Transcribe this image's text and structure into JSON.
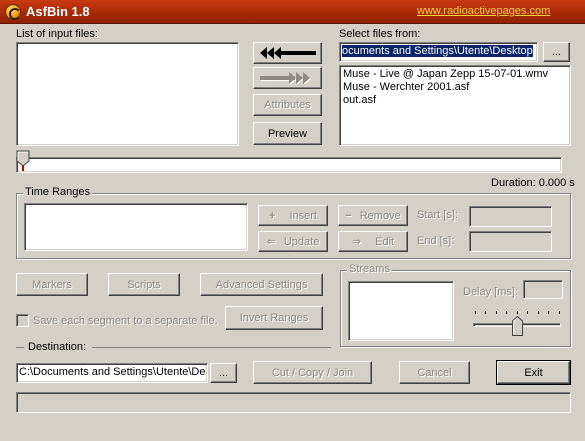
{
  "window": {
    "title": "AsfBin 1.8",
    "link": "www.radioactivepages.com"
  },
  "input_files": {
    "label": "List of input files:",
    "items": []
  },
  "select_files": {
    "label": "Select files from:",
    "path": "ocuments and Settings\\Utente\\Desktop",
    "browse_label": "...",
    "files": [
      "Muse - Live @ Japan Zepp 15-07-01.wmv",
      "Muse - Werchter 2001.asf",
      "out.asf"
    ]
  },
  "buttons": {
    "attributes": "Attributes",
    "preview": "Preview",
    "markers": "Markers",
    "scripts": "Scripts",
    "advanced_settings": "Advanced Settings",
    "invert_ranges": "Invert Ranges",
    "cut_copy_join": "Cut / Copy / Join",
    "cancel": "Cancel",
    "exit": "Exit",
    "destination_browse": "..."
  },
  "timeline": {
    "duration_label": "Duration: 0.000 s",
    "position": 0
  },
  "time_ranges": {
    "label": "Time Ranges",
    "insert": "Insert",
    "remove": "Remove",
    "update": "Update",
    "edit": "Edit",
    "start_label": "Start [s]:",
    "end_label": "End [s]:",
    "start_value": "",
    "end_value": ""
  },
  "streams": {
    "label": "Streams",
    "delay_label": "Delay [ms]:",
    "delay_value": "",
    "slider_position": 0.5
  },
  "options": {
    "save_segments": "Save each segment to a separate file.",
    "save_segments_checked": false
  },
  "destination": {
    "label": "Destination:",
    "path": "C:\\Documents and Settings\\Utente\\De"
  },
  "status_bar": {
    "text": ""
  }
}
